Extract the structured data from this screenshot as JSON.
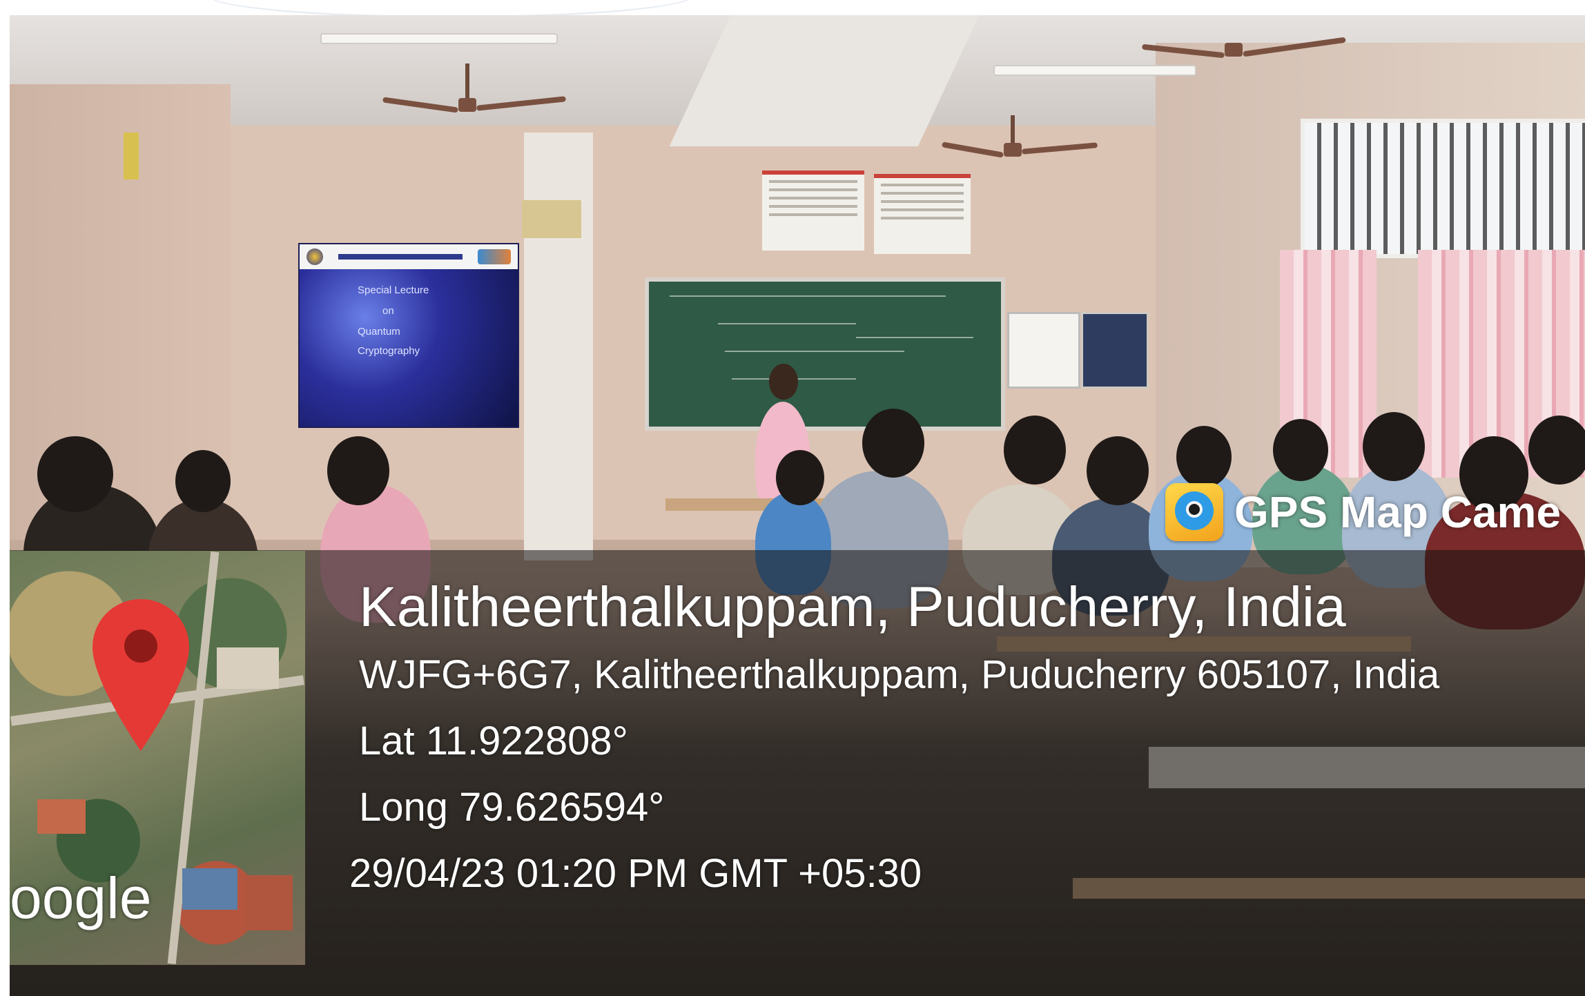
{
  "badge": {
    "label": "GPS Map Came",
    "icon": "map-pin-icon"
  },
  "location": {
    "city_line": "Kalitheerthalkuppam, Puducherry, India",
    "address": "WJFG+6G7, Kalitheerthalkuppam, Puducherry 605107, India",
    "latitude": "Lat 11.922808°",
    "longitude": "Long 79.626594°",
    "timestamp": "29/04/23 01:20 PM GMT +05:30"
  },
  "map": {
    "attribution": "oogle",
    "pin_icon": "location-pin-icon",
    "pin_color": "#e53935"
  },
  "slide": {
    "line1": "Special Lecture",
    "line2": "on",
    "line3": "Quantum",
    "line4": "Cryptography"
  },
  "colors": {
    "overlay": "#141210",
    "badge_icon": "#f3a31c",
    "text": "#ffffff"
  }
}
